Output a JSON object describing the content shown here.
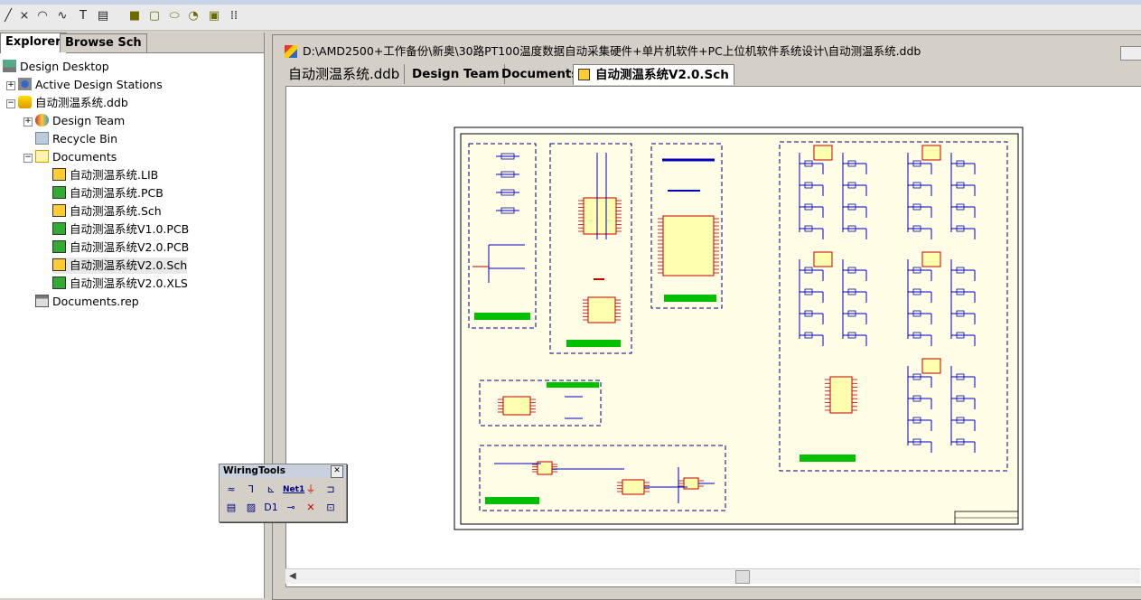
{
  "toolbar": {
    "icons": [
      "line-icon",
      "arc-icon",
      "ellipse-arc-icon",
      "bezier-icon",
      "text-icon",
      "text-frame-icon",
      "rectangle-icon",
      "rounded-rectangle-icon",
      "ellipse-icon",
      "pie-icon",
      "graphic-icon",
      "array-icon"
    ],
    "glyphs": [
      "╱",
      "⨯",
      "◠",
      "∿",
      "T",
      "▤",
      "■",
      "▢",
      "⬭",
      "◔",
      "▣",
      "⁞⁞"
    ]
  },
  "explorer": {
    "tabs": [
      "Explorer",
      "Browse Sch"
    ],
    "tree": {
      "desktop": "Design Desktop",
      "stations": "Active Design Stations",
      "ddb": "自动测温系统.ddb",
      "team": "Design Team",
      "recycle": "Recycle Bin",
      "documents": "Documents",
      "files": [
        "自动测温系统.LIB",
        "自动测温系统.PCB",
        "自动测温系统.Sch",
        "自动测温系统V1.0.PCB",
        "自动测温系统V2.0.PCB",
        "自动测温系统V2.0.Sch",
        "自动测温系统V2.0.XLS"
      ],
      "report": "Documents.rep"
    }
  },
  "wiring": {
    "title": "WiringTools",
    "close": "✕",
    "row1": [
      "≈",
      "⅂",
      "⊾",
      "Net1",
      "⏚",
      "⊐"
    ],
    "row2": [
      "▤",
      "▨",
      "D1",
      "⊸",
      "✕",
      "⊡"
    ]
  },
  "document": {
    "path": "D:\\AMD2500+工作备份\\新奥\\30路PT100温度数据自动采集硬件+单片机软件+PC上位机软件系统设计\\自动测温系统.ddb",
    "tabs": [
      "自动测温系统.ddb",
      "Design Team",
      "Documents",
      "自动测温系统V2.0.Sch"
    ]
  },
  "colors": {
    "sheet": "#fffde6",
    "wire": "#0000c0",
    "pin": "#c00000",
    "label": "#00c000",
    "part": "#ffffb0"
  }
}
